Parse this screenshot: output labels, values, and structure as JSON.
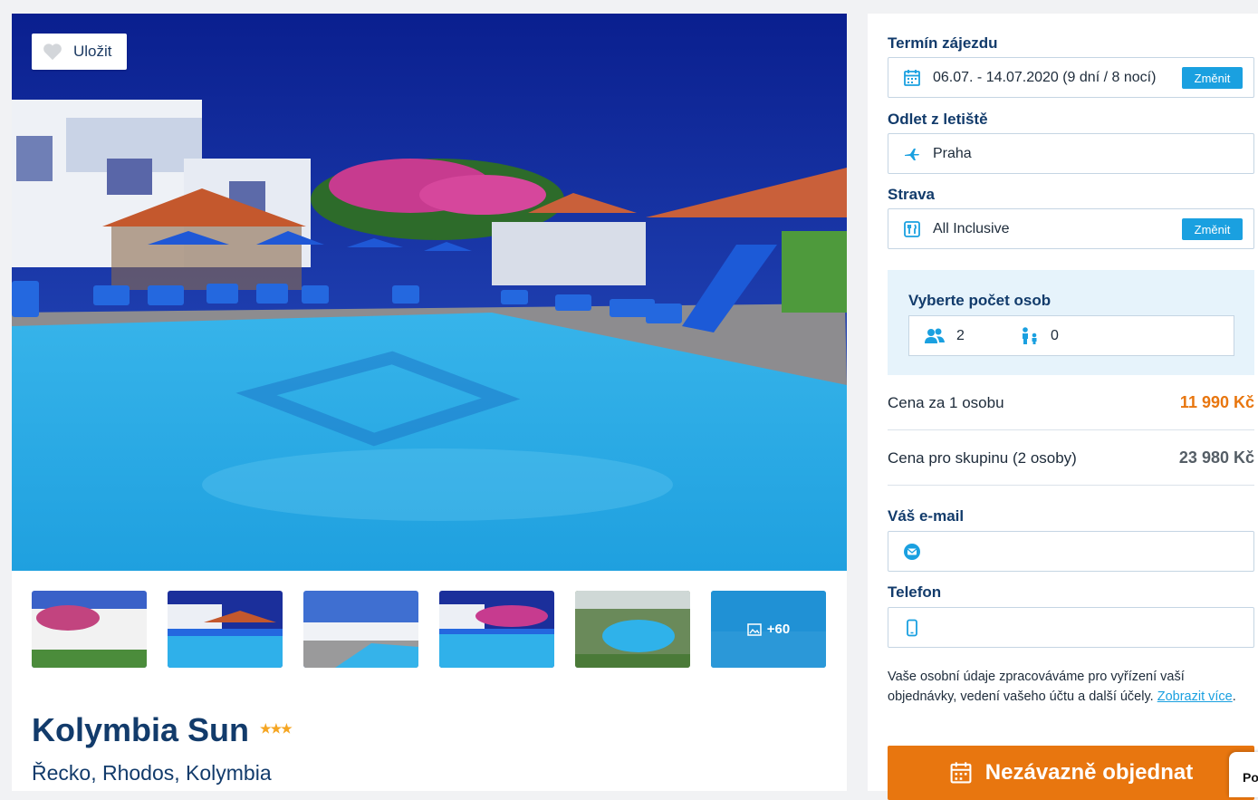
{
  "gallery": {
    "save_label": "Uložit",
    "more_count": "+60"
  },
  "hotel": {
    "name": "Kolymbia Sun",
    "stars": "★★★",
    "location": "Řecko, Rhodos, Kolymbia",
    "star_count": 3
  },
  "booking": {
    "term_label": "Termín zájezdu",
    "term_value": "06.07. - 14.07.2020 (9 dní / 8 nocí)",
    "change_label": "Změnit",
    "airport_label": "Odlet z letiště",
    "airport_value": "Praha",
    "board_label": "Strava",
    "board_value": "All Inclusive",
    "persons_title": "Vyberte počet osob",
    "adults": "2",
    "children": "0",
    "price_per_person_label": "Cena za 1 osobu",
    "price_per_person": "11 990 Kč",
    "price_group_label": "Cena pro skupinu (2 osoby)",
    "price_group": "23 980 Kč",
    "email_label": "Váš e-mail",
    "email_value": "",
    "phone_label": "Telefon",
    "phone_value": "",
    "consent_text": "Vaše osobní údaje zpracováváme pro vyřízení vaší objednávky, vedení vašeho účtu a další účely.",
    "consent_link": "Zobrazit více",
    "order_label": "Nezávazně objednat",
    "chat_label": "Po"
  },
  "colors": {
    "brand_blue": "#123b6b",
    "accent_blue": "#1aa0e0",
    "price_orange": "#e8760f",
    "order_button": "#e8760f",
    "star": "#f5a623"
  },
  "icons": [
    "heart-icon",
    "calendar-icon",
    "plane-icon",
    "cutlery-icon",
    "adults-icon",
    "child-icon",
    "email-icon",
    "phone-icon",
    "gallery-icon"
  ]
}
